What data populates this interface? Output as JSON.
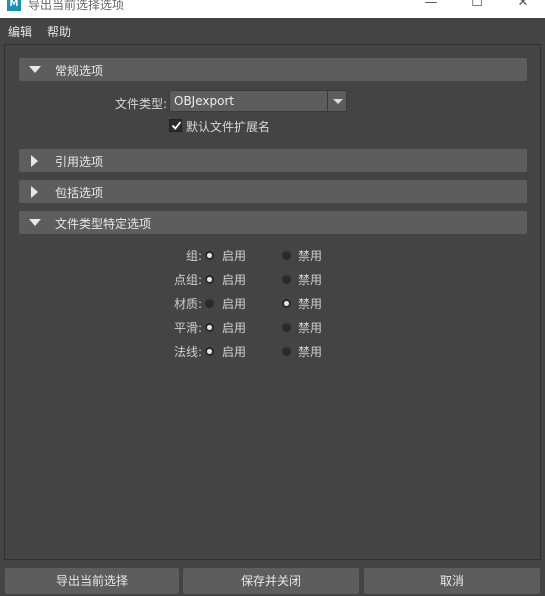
{
  "window": {
    "title": "导出当前选择选项",
    "app_icon_letter": "M",
    "minimize_glyph": "—",
    "maximize_glyph": "☐",
    "close_glyph": "✕"
  },
  "menu": {
    "edit": "编辑",
    "help": "帮助"
  },
  "sections": {
    "general": {
      "label": "常规选项",
      "expanded": true
    },
    "references": {
      "label": "引用选项",
      "expanded": false
    },
    "include": {
      "label": "包括选项",
      "expanded": false
    },
    "file_type_specific": {
      "label": "文件类型特定选项",
      "expanded": true
    }
  },
  "general": {
    "file_type_label": "文件类型:",
    "file_type_value": "OBJexport",
    "default_ext_label": "默认文件扩展名",
    "default_ext_checked": true
  },
  "options": {
    "on_label": "启用",
    "off_label": "禁用",
    "rows": [
      {
        "label": "组:",
        "enabled": true
      },
      {
        "label": "点组:",
        "enabled": true
      },
      {
        "label": "材质:",
        "enabled": false
      },
      {
        "label": "平滑:",
        "enabled": true
      },
      {
        "label": "法线:",
        "enabled": true
      }
    ]
  },
  "footer": {
    "export": "导出当前选择",
    "save_close": "保存并关闭",
    "cancel": "取消"
  },
  "colors": {
    "background": "#444444",
    "section_header": "#5d5d5d",
    "button": "#5d5d5d"
  }
}
